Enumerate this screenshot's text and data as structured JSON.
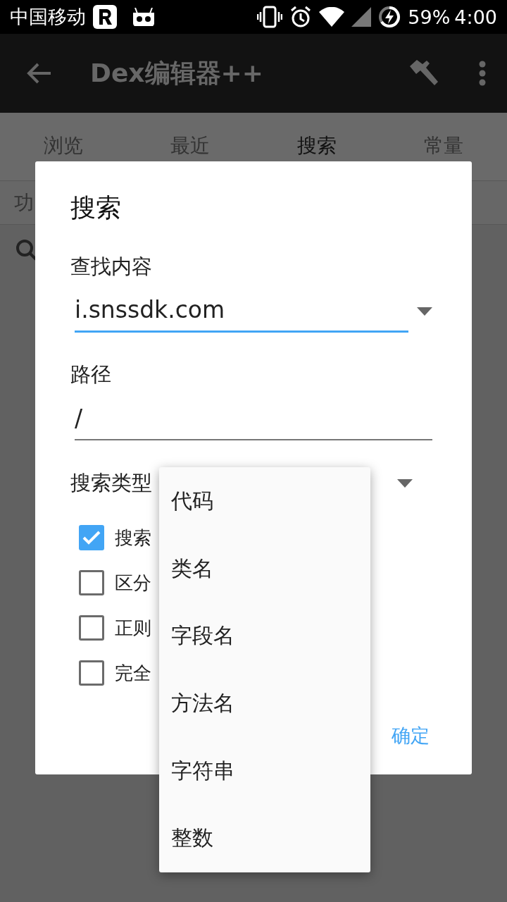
{
  "status_bar": {
    "carrier": "中国移动",
    "battery": "59%",
    "time": "4:00"
  },
  "app_bar": {
    "title": "Dex编辑器++"
  },
  "tabs": [
    {
      "label": "浏览",
      "selected": false
    },
    {
      "label": "最近",
      "selected": false
    },
    {
      "label": "搜索",
      "selected": true
    },
    {
      "label": "常量",
      "selected": false
    }
  ],
  "list_header": {
    "text": "功"
  },
  "dialog": {
    "title": "搜索",
    "fields": [
      {
        "label": "查找内容",
        "value": "i.snssdk.com",
        "kind": "dropdown",
        "focused": true
      },
      {
        "label": "路径",
        "value": "/",
        "kind": "text",
        "focused": false
      }
    ],
    "search_type": {
      "label": "搜索类型"
    },
    "options": [
      {
        "label": "搜索",
        "checked": true
      },
      {
        "label": "区分",
        "checked": false
      },
      {
        "label": "正则",
        "checked": false
      },
      {
        "label": "完全",
        "checked": false
      }
    ],
    "confirm": "确定"
  },
  "menu": {
    "items": [
      {
        "label": "代码"
      },
      {
        "label": "类名"
      },
      {
        "label": "字段名"
      },
      {
        "label": "方法名"
      },
      {
        "label": "字符串"
      },
      {
        "label": "整数"
      }
    ]
  }
}
